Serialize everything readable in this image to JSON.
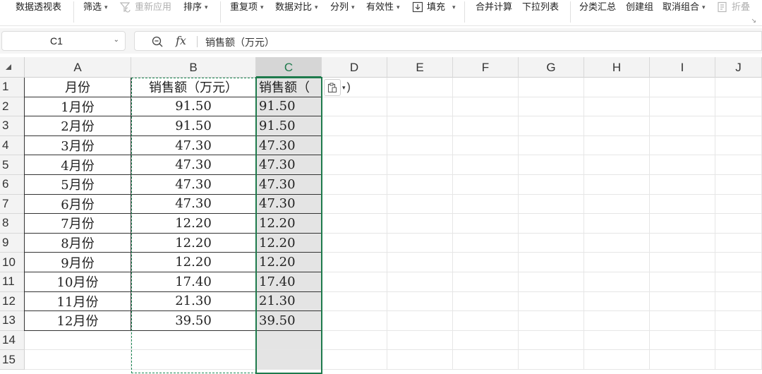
{
  "ribbon": {
    "items": [
      {
        "label": "数据透视表",
        "caret": false,
        "disabled": false
      },
      {
        "label": "筛选",
        "caret": true,
        "disabled": false
      },
      {
        "label": "重新应用",
        "caret": false,
        "disabled": true,
        "icon": "reapply-filter-icon"
      },
      {
        "label": "排序",
        "caret": true,
        "disabled": false
      },
      {
        "label": "重复项",
        "caret": true,
        "disabled": false
      },
      {
        "label": "数据对比",
        "caret": true,
        "disabled": false
      },
      {
        "label": "分列",
        "caret": true,
        "disabled": false
      },
      {
        "label": "有效性",
        "caret": true,
        "disabled": false
      },
      {
        "label": "填充",
        "caret": true,
        "disabled": false,
        "icon": "fill-icon"
      },
      {
        "label": "合并计算",
        "caret": false,
        "disabled": false
      },
      {
        "label": "下拉列表",
        "caret": false,
        "disabled": false
      },
      {
        "label": "分类汇总",
        "caret": false,
        "disabled": false
      },
      {
        "label": "创建组",
        "caret": false,
        "disabled": false
      },
      {
        "label": "取消组合",
        "caret": true,
        "disabled": false
      },
      {
        "label": "折叠",
        "caret": false,
        "disabled": true,
        "icon": "collapse-icon"
      }
    ]
  },
  "formula_bar": {
    "cell_ref": "C1",
    "fx_label": "fx",
    "content": "销售额（万元）"
  },
  "columns": [
    "A",
    "B",
    "C",
    "D",
    "E",
    "F",
    "G",
    "H",
    "I",
    "J"
  ],
  "selected_column": "C",
  "rows": [
    "1",
    "2",
    "3",
    "4",
    "5",
    "6",
    "7",
    "8",
    "9",
    "10",
    "11",
    "12",
    "13",
    "14",
    "15"
  ],
  "table": {
    "header_a": "月份",
    "header_b": "销售额（万元）",
    "header_c": "销售额（",
    "data": [
      [
        "1月份",
        "91.50",
        "91.50"
      ],
      [
        "2月份",
        "91.50",
        "91.50"
      ],
      [
        "3月份",
        "47.30",
        "47.30"
      ],
      [
        "4月份",
        "47.30",
        "47.30"
      ],
      [
        "5月份",
        "47.30",
        "47.30"
      ],
      [
        "6月份",
        "47.30",
        "47.30"
      ],
      [
        "7月份",
        "12.20",
        "12.20"
      ],
      [
        "8月份",
        "12.20",
        "12.20"
      ],
      [
        "9月份",
        "12.20",
        "12.20"
      ],
      [
        "10月份",
        "17.40",
        "17.40"
      ],
      [
        "11月份",
        "21.30",
        "21.30"
      ],
      [
        "12月份",
        "39.50",
        "39.50"
      ]
    ],
    "paste_suffix": ")"
  },
  "colors": {
    "accent": "#1e7a4c",
    "selected_col_bg": "#e4e4e4"
  }
}
